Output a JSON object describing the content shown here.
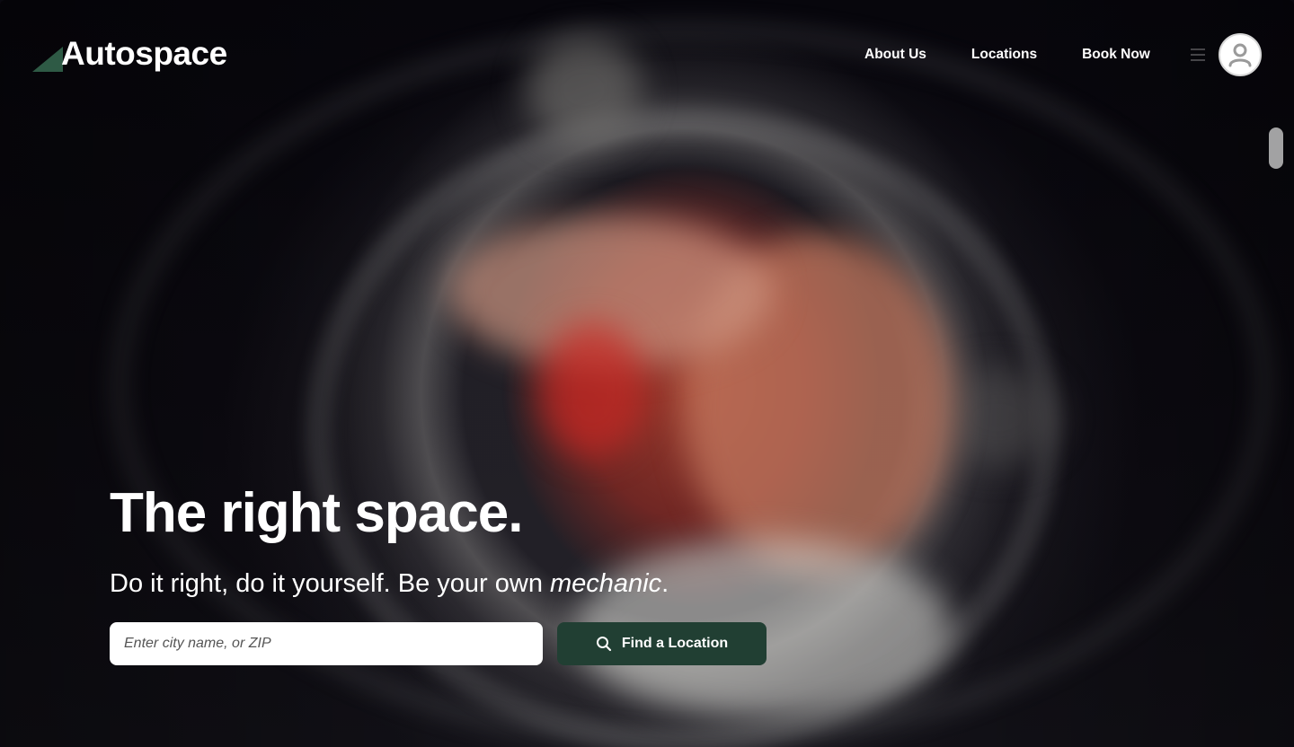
{
  "brand": {
    "name": "Autospace",
    "accent_color": "#2e5a45",
    "button_color": "#213f33"
  },
  "nav": {
    "items": [
      {
        "label": "About Us"
      },
      {
        "label": "Locations"
      },
      {
        "label": "Book Now"
      }
    ],
    "menu_icon": "hamburger-icon",
    "avatar_icon": "user-avatar-icon"
  },
  "hero": {
    "headline": "The right space.",
    "subline_main": "Do it right, do it yourself. Be your own ",
    "subline_emphasis": "mechanic",
    "subline_end": ".",
    "search": {
      "placeholder": "Enter city name, or ZIP",
      "value": ""
    },
    "cta": {
      "label": "Find a Location",
      "icon": "search-icon"
    }
  }
}
